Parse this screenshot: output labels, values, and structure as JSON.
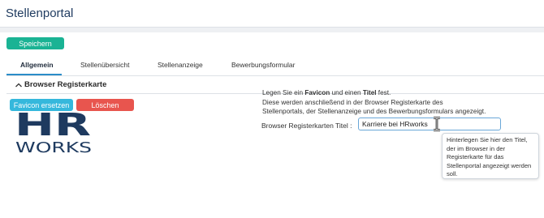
{
  "header": {
    "title": "Stellenportal"
  },
  "toolbar": {
    "save_label": "Speichern"
  },
  "tabs": [
    {
      "label": "Allgemein",
      "active": true
    },
    {
      "label": "Stellenübersicht",
      "active": false
    },
    {
      "label": "Stellenanzeige",
      "active": false
    },
    {
      "label": "Bewerbungsformular",
      "active": false
    }
  ],
  "section": {
    "title": "Browser Registerkarte",
    "icon": "chevron-up-icon"
  },
  "buttons": {
    "favicon_label": "Favicon ersetzen",
    "delete_label": "Löschen"
  },
  "logo": {
    "line1": "HR",
    "line2": "WORKS"
  },
  "info": {
    "part1": "Legen Sie ein ",
    "bold1": "Favicon",
    "part2": " und einen ",
    "bold2": "Titel",
    "part3": " fest.",
    "line2": "Diese werden anschließend in der Browser Registerkarte des",
    "line3": "Stellenportals, der Stellenanzeige und des Bewerbungsformulars angezeigt."
  },
  "field": {
    "label": "Browser Registerkarten Titel :",
    "value": "Karriere bei HRworks"
  },
  "tooltip": {
    "text": "Hinterlegen Sie hier den Titel, der im Browser in der Registerkarte für das Stellenportal angezeigt werden soll."
  },
  "colors": {
    "save": "#1ab394",
    "favicon": "#35b8dc",
    "delete": "#e8554e",
    "brand": "#1e3a5f"
  }
}
